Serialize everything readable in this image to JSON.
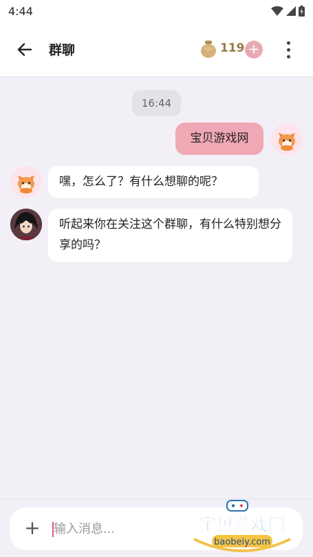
{
  "status_bar": {
    "time": "4:44"
  },
  "app_bar": {
    "title": "群聊",
    "coin_count": "119",
    "add_label": "+"
  },
  "chat": {
    "timestamp": "16:44",
    "messages": [
      {
        "sender": "me",
        "text": "宝贝游戏网"
      },
      {
        "sender": "fox-bot",
        "text": "嘿，怎么了？有什么想聊的呢？"
      },
      {
        "sender": "character",
        "text": "听起来你在关注这个群聊，有什么特别想分享的吗？"
      }
    ]
  },
  "composer": {
    "attach_label": "+",
    "placeholder": "输入消息..."
  },
  "watermark": {
    "title": "宝贝游戏网",
    "url": "baobeiy.com"
  }
}
